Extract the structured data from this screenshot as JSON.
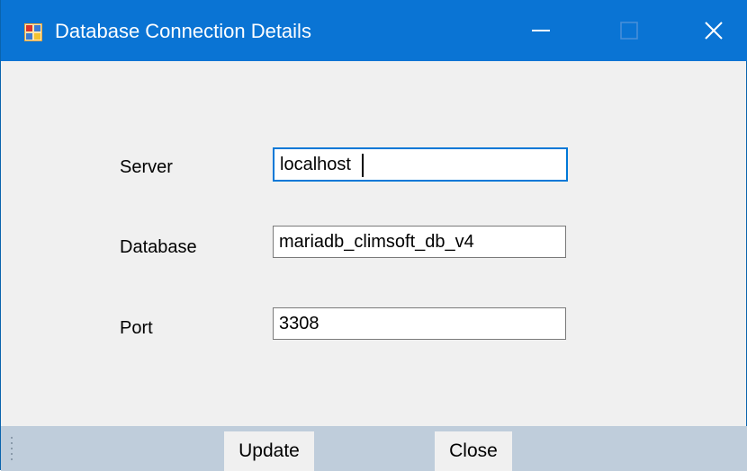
{
  "window": {
    "title": "Database Connection Details",
    "accent_color": "#0a74d4",
    "icons": {
      "app": "app-form-icon",
      "minimize": "minimize-icon",
      "maximize": "maximize-icon",
      "close": "close-icon"
    }
  },
  "form": {
    "server": {
      "label": "Server",
      "value": "localhost"
    },
    "database": {
      "label": "Database",
      "value": "mariadb_climsoft_db_v4"
    },
    "port": {
      "label": "Port",
      "value": "3308"
    }
  },
  "toolbar": {
    "update_label": "Update",
    "close_label": "Close"
  }
}
